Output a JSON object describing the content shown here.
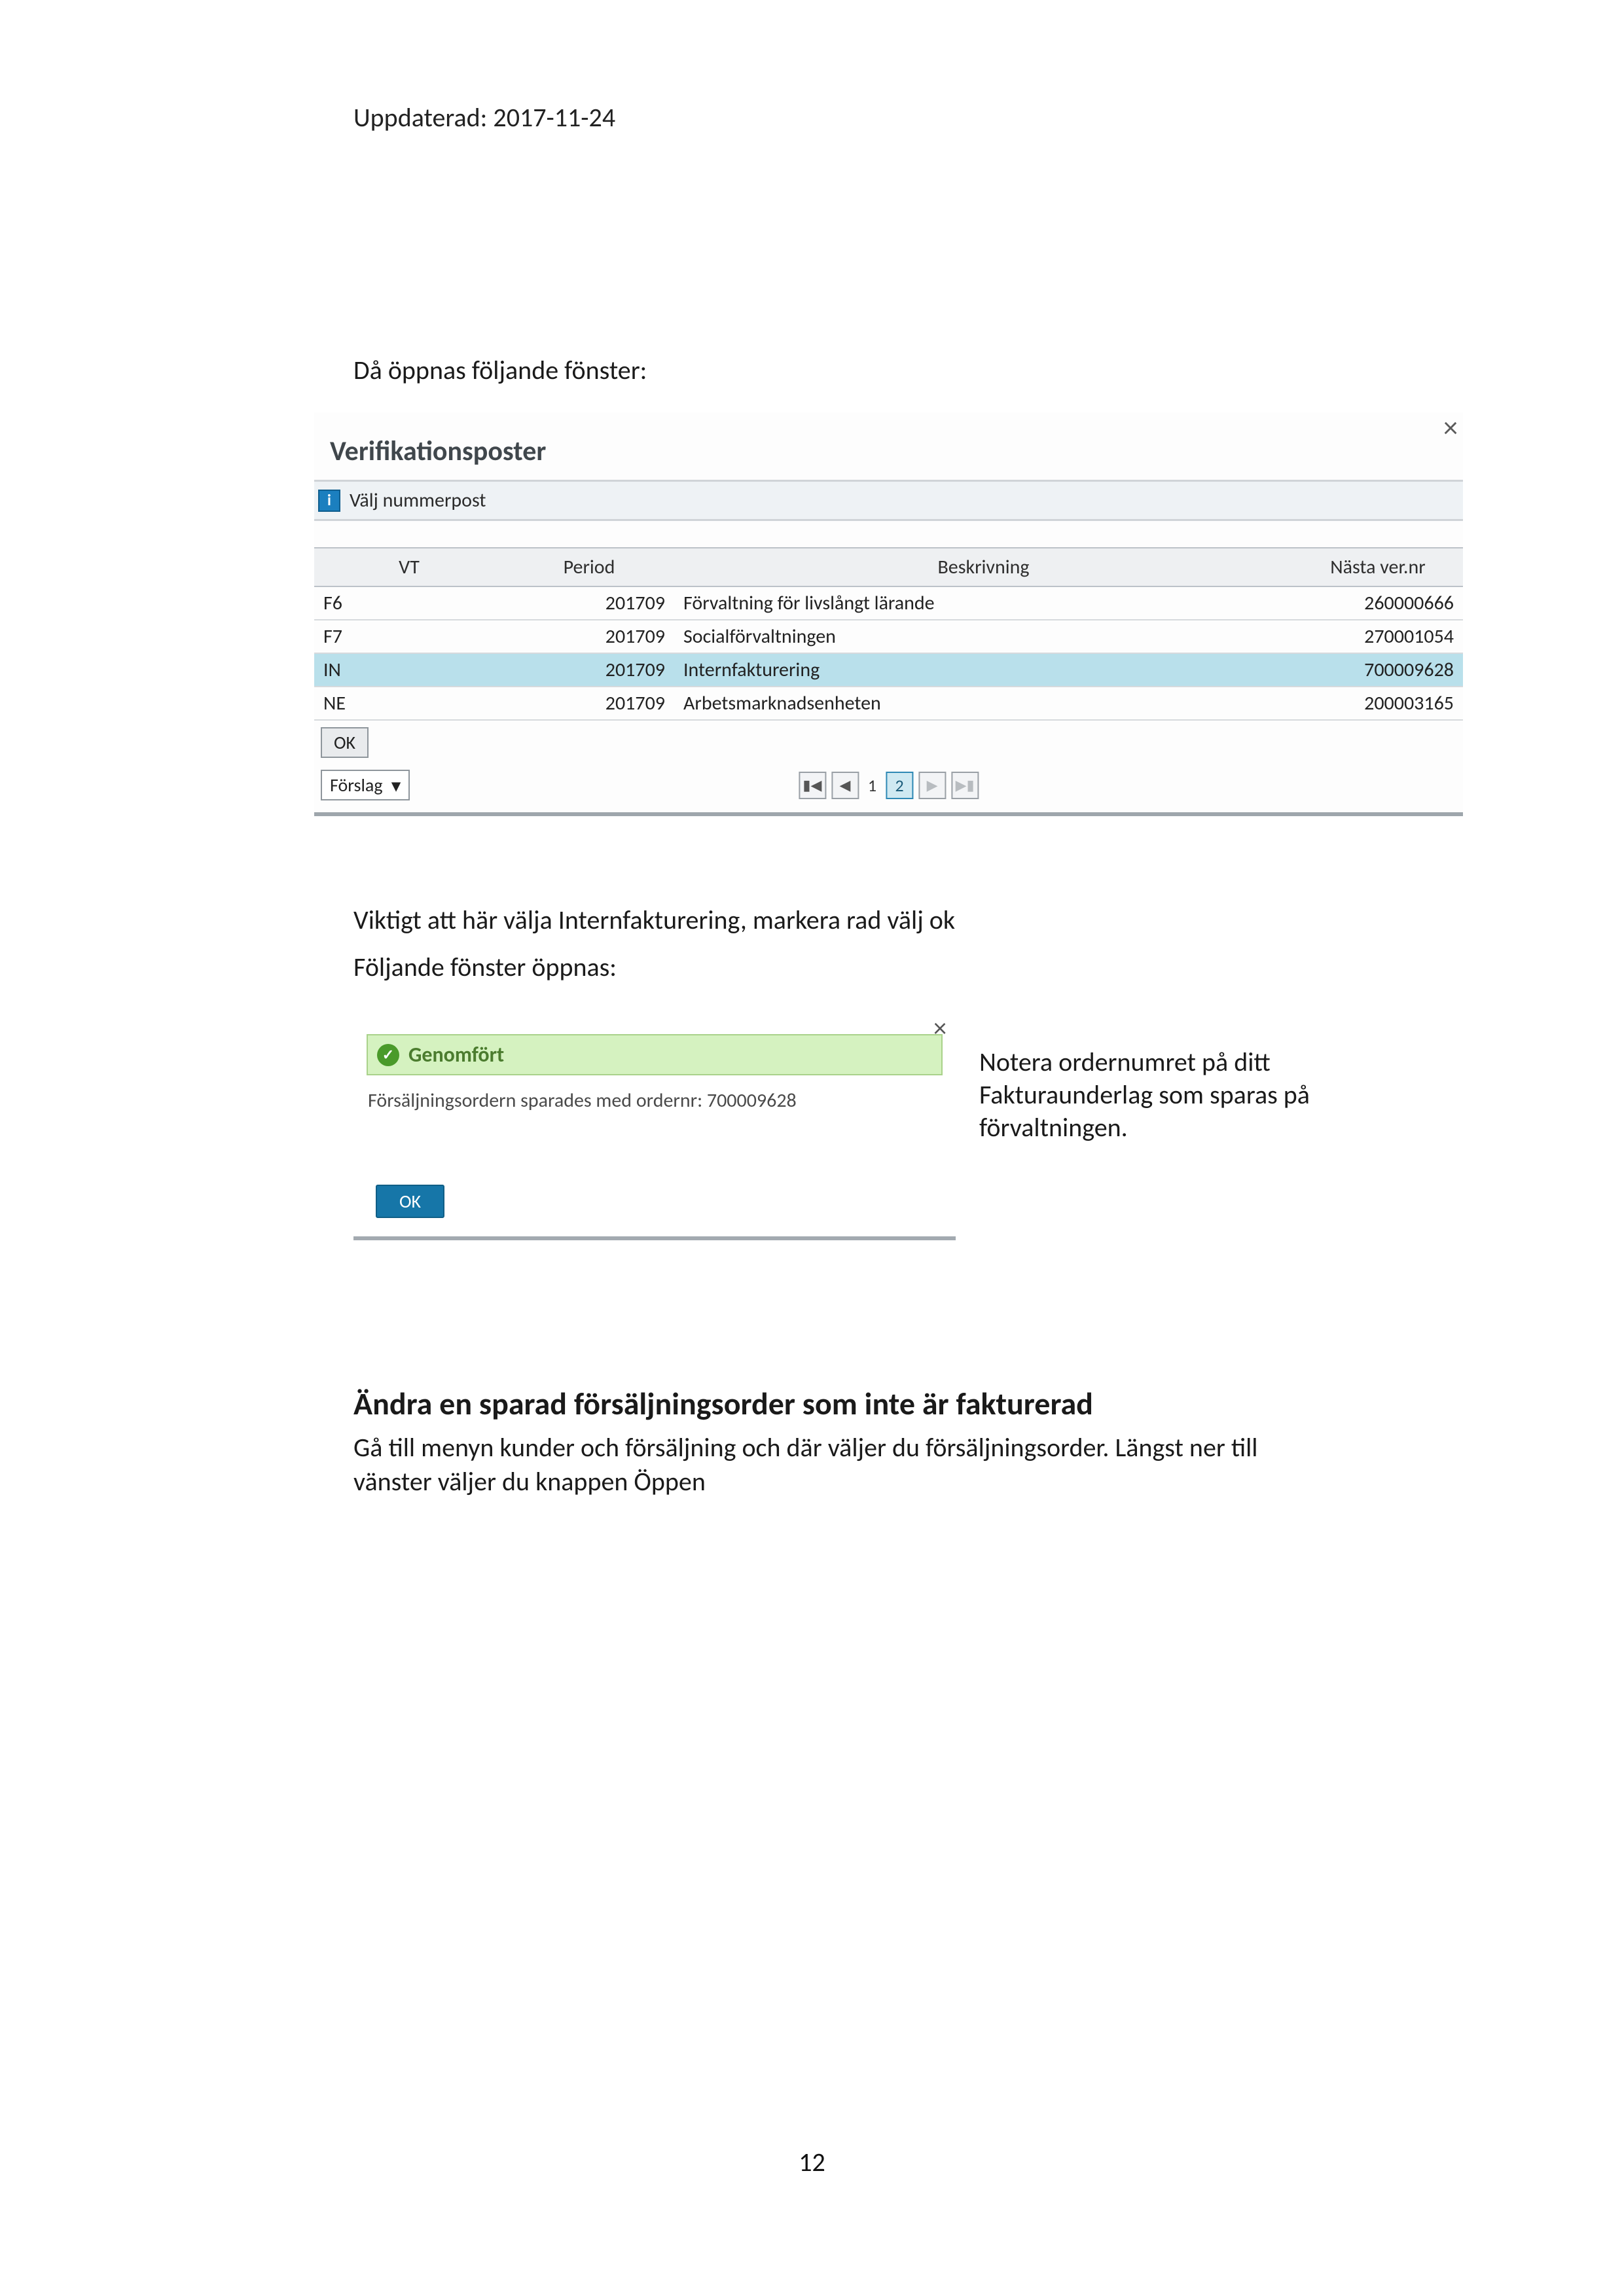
{
  "meta": {
    "updated_label": "Uppdaterad: 2017-11-24",
    "page_number": "12"
  },
  "intro": {
    "p1": "Då öppnas följande fönster:"
  },
  "dialog1": {
    "title": "Verifikationsposter",
    "info_text": "Välj nummerpost",
    "columns": {
      "vt": "VT",
      "period": "Period",
      "desc": "Beskrivning",
      "ver": "Nästa ver.nr"
    },
    "rows": [
      {
        "vt": "F6",
        "period": "201709",
        "desc": "Förvaltning för livslångt lärande",
        "ver": "260000666",
        "selected": false
      },
      {
        "vt": "F7",
        "period": "201709",
        "desc": "Socialförvaltningen",
        "ver": "270001054",
        "selected": false
      },
      {
        "vt": "IN",
        "period": "201709",
        "desc": "Internfakturering",
        "ver": "700009628",
        "selected": true
      },
      {
        "vt": "NE",
        "period": "201709",
        "desc": "Arbetsmarknadsenheten",
        "ver": "200003165",
        "selected": false
      }
    ],
    "ok_label": "OK",
    "dropdown_label": "Förslag",
    "pager": {
      "current": "2",
      "other": "1"
    }
  },
  "mid": {
    "p1": "Viktigt att här välja Internfakturering, markera rad välj ok",
    "p2": "Följande fönster öppnas:"
  },
  "dialog2": {
    "bar_title": "Genomfört",
    "message": "Försäljningsordern sparades med ordernr: 700009628",
    "ok_label": "OK"
  },
  "note": {
    "text": "Notera ordernumret på ditt Fakturaunderlag som sparas på förvaltningen."
  },
  "section2": {
    "heading": "Ändra en sparad försäljningsorder som inte är fakturerad",
    "p1": "Gå till menyn kunder och försäljning och där väljer du försäljningsorder. Längst ner till vänster väljer du knappen Öppen"
  }
}
